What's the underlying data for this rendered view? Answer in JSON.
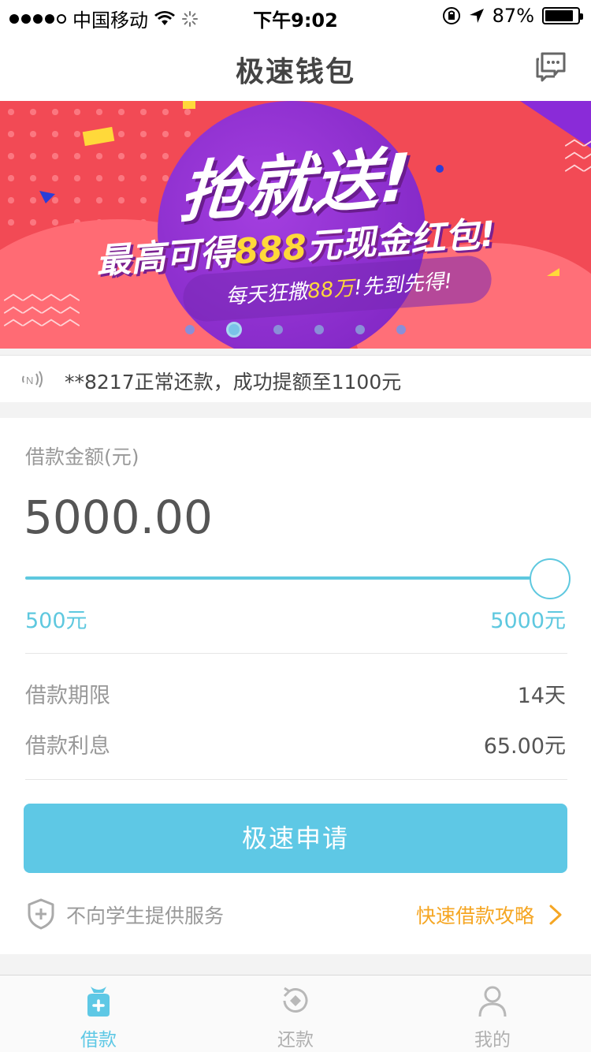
{
  "status_bar": {
    "carrier": "中国移动",
    "time": "下午9:02",
    "battery_percent": "87%",
    "battery_level": 0.87
  },
  "nav": {
    "title": "极速钱包",
    "message_icon": "chat-bubbles-icon"
  },
  "banner": {
    "headline": "抢就送!",
    "subline_prefix": "最高可得",
    "subline_highlight": "888",
    "subline_suffix": "元现金红包!",
    "tagline_prefix": "每天狂撒",
    "tagline_highlight": "88万",
    "tagline_suffix": "!先到先得!",
    "slide_count": 6,
    "active_slide": 2,
    "colors": {
      "background": "#f24a55",
      "accent": "#a43fe0",
      "highlight": "#ffd93a"
    }
  },
  "notice": {
    "icon": "broadcast-icon",
    "text": "**8217正常还款，成功提额至1100元"
  },
  "loan": {
    "amount_label": "借款金额(元)",
    "amount_value": "5000.00",
    "slider": {
      "min_label": "500元",
      "max_label": "5000元",
      "min": 500,
      "max": 5000,
      "value": 5000
    },
    "term_label": "借款期限",
    "term_value": "14天",
    "interest_label": "借款利息",
    "interest_value": "65.00元",
    "apply_button": "极速申请",
    "student_notice": "不向学生提供服务",
    "guide_link": "快速借款攻略",
    "accent_color": "#5ec8e5",
    "link_color": "#f5a623"
  },
  "tabbar": {
    "tabs": [
      {
        "label": "借款",
        "icon": "money-bag-icon",
        "active": true
      },
      {
        "label": "还款",
        "icon": "repay-cycle-icon",
        "active": false
      },
      {
        "label": "我的",
        "icon": "person-icon",
        "active": false
      }
    ]
  }
}
